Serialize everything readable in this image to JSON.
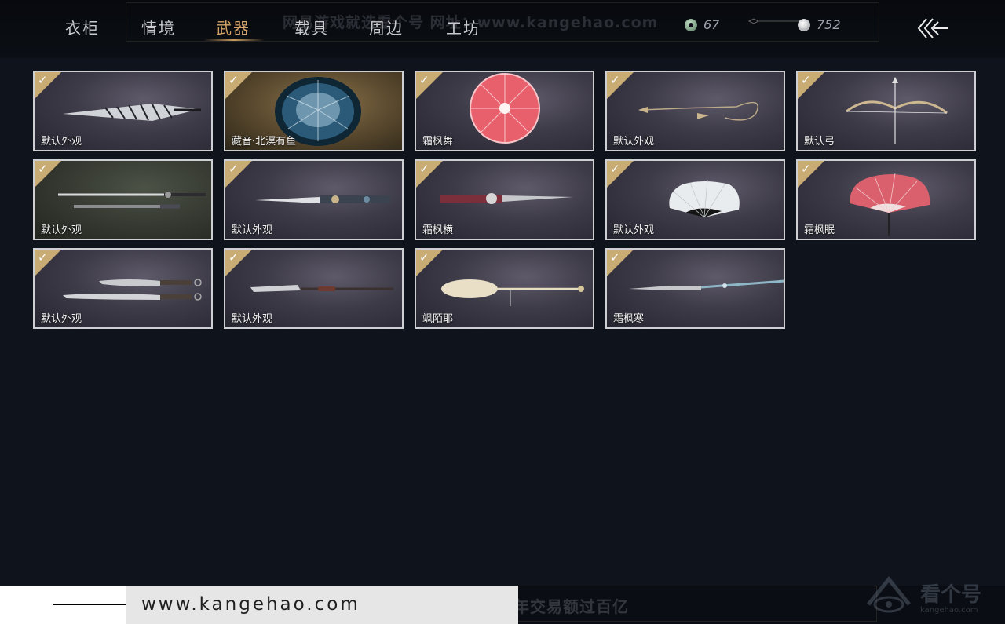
{
  "tabs": [
    {
      "label": "衣柜",
      "active": false
    },
    {
      "label": "情境",
      "active": false
    },
    {
      "label": "武器",
      "active": true
    },
    {
      "label": "载具",
      "active": false
    },
    {
      "label": "周边",
      "active": false
    },
    {
      "label": "工坊",
      "active": false
    }
  ],
  "watermark_top": "网易游戏就选看个号  网址：www.kangehao.com",
  "currency": {
    "jade": {
      "icon": "jade-coin-icon",
      "value": "67"
    },
    "silver": {
      "icon": "silver-coin-icon",
      "value": "752"
    }
  },
  "back_icon": "back-arrow-icon",
  "colors": {
    "accent": "#d4a468",
    "badge": "#c9ac74",
    "card_border": "#cdcfd2"
  },
  "items": [
    {
      "name": "默认外观",
      "owned": true,
      "icon": "umbrella-closed-icon"
    },
    {
      "name": "藏音·北溟有鱼",
      "owned": true,
      "icon": "umbrella-open-blue-icon"
    },
    {
      "name": "霜枫舞",
      "owned": true,
      "icon": "umbrella-open-red-icon"
    },
    {
      "name": "默认外观",
      "owned": true,
      "icon": "rope-dart-icon"
    },
    {
      "name": "默认弓",
      "owned": true,
      "icon": "bow-icon"
    },
    {
      "name": "默认外观",
      "owned": true,
      "icon": "twin-swords-icon"
    },
    {
      "name": "默认外观",
      "owned": true,
      "icon": "sword-icon"
    },
    {
      "name": "霜枫横",
      "owned": true,
      "icon": "sword-red-icon"
    },
    {
      "name": "默认外观",
      "owned": true,
      "icon": "fan-white-icon"
    },
    {
      "name": "霜枫眠",
      "owned": true,
      "icon": "fan-red-icon"
    },
    {
      "name": "默认外观",
      "owned": true,
      "icon": "dual-blades-icon"
    },
    {
      "name": "默认外观",
      "owned": true,
      "icon": "spear-icon"
    },
    {
      "name": "飒陌耶",
      "owned": true,
      "icon": "ladle-staff-icon"
    },
    {
      "name": "霜枫寒",
      "owned": true,
      "icon": "long-spear-icon"
    }
  ],
  "bottom": {
    "url": "www.kangehao.com",
    "slogan": "看个号专业网易游戏八年  年交易额过百亿",
    "brand_name": "看个号",
    "brand_sub": "kangehao.com"
  }
}
